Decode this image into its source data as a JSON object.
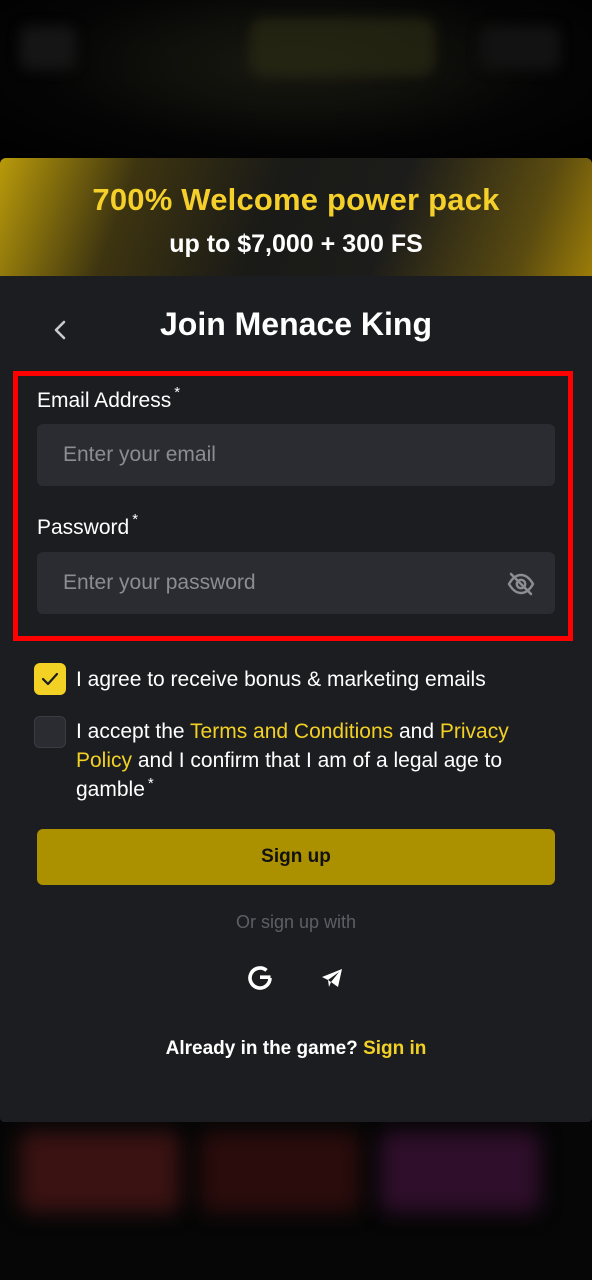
{
  "banner": {
    "title": "700% Welcome power pack",
    "subtitle": "up to $7,000 + 300 FS"
  },
  "header": {
    "title": "Join Menace King",
    "back_icon": "chevron-left-icon"
  },
  "form": {
    "email": {
      "label": "Email Address",
      "required_mark": "*",
      "placeholder": "Enter your email",
      "value": ""
    },
    "password": {
      "label": "Password",
      "required_mark": "*",
      "placeholder": "Enter your password",
      "value": "",
      "toggle_icon": "eye-off-icon"
    }
  },
  "consents": {
    "marketing": {
      "checked": true,
      "text": "I agree to receive bonus & marketing emails"
    },
    "terms": {
      "checked": false,
      "text_before": "I accept the ",
      "terms_link": "Terms and Conditions",
      "text_mid": " and ",
      "privacy_link": "Privacy Policy",
      "text_after": " and I confirm that I am of a legal age to gamble",
      "required_mark": "*"
    }
  },
  "signup_button": "Sign up",
  "social": {
    "label": "Or sign up with",
    "providers": [
      "google-icon",
      "telegram-icon"
    ]
  },
  "footer": {
    "question": "Already in the game?",
    "signin_link": "Sign in"
  },
  "colors": {
    "accent": "#f2d024",
    "button": "#ab9000",
    "modal_bg": "#1c1d21",
    "input_bg": "#2a2c31",
    "highlight": "#ff0000"
  }
}
